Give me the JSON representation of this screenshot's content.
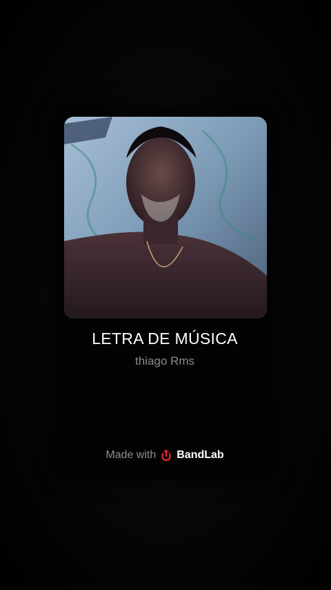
{
  "track": {
    "title": "LETRA DE MÚSICA",
    "artist": "thiago Rms"
  },
  "footer": {
    "made_with": "Made with",
    "brand": "BandLab",
    "brand_icon": "bandlab-logo-icon",
    "brand_color": "#e3242b"
  }
}
